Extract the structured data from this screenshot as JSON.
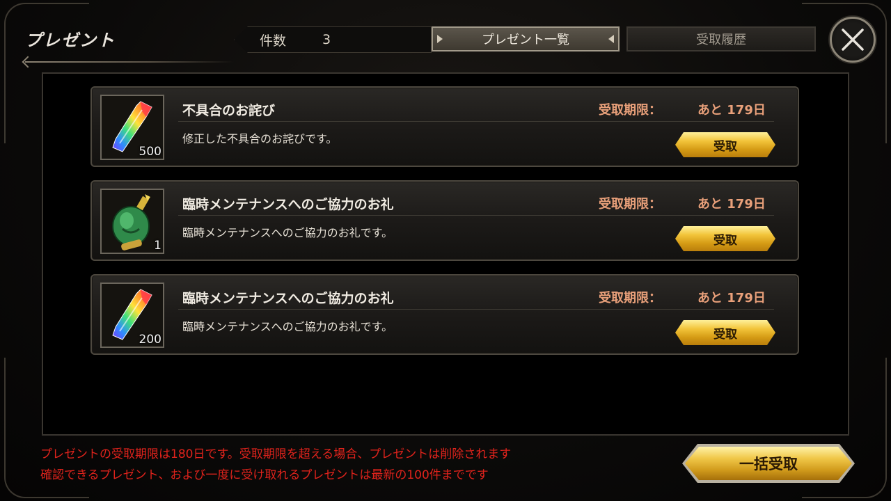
{
  "header": {
    "title": "プレゼント",
    "count_label": "件数",
    "count_value": "3",
    "tabs": [
      {
        "label": "プレゼント一覧",
        "active": true
      },
      {
        "label": "受取履歴",
        "active": false
      }
    ],
    "close_icon": "close-icon"
  },
  "presents": [
    {
      "title": "不具合のお詫び",
      "description": "修正した不具合のお詫びです。",
      "limit_label": "受取期限：",
      "limit_value": "あと 179日",
      "quantity": "500",
      "icon": "rainbow-crystal-icon",
      "button_label": "受取"
    },
    {
      "title": "臨時メンテナンスへのご協力のお礼",
      "description": "臨時メンテナンスへのご協力のお礼です。",
      "limit_label": "受取期限：",
      "limit_value": "あと 179日",
      "quantity": "1",
      "icon": "green-potion-icon",
      "button_label": "受取"
    },
    {
      "title": "臨時メンテナンスへのご協力のお礼",
      "description": "臨時メンテナンスへのご協力のお礼です。",
      "limit_label": "受取期限：",
      "limit_value": "あと 179日",
      "quantity": "200",
      "icon": "rainbow-crystal-icon",
      "button_label": "受取"
    }
  ],
  "footer": {
    "notice_lines": [
      "プレゼントの受取期限は180日です。受取期限を超える場合、プレゼントは削除されます",
      "確認できるプレゼント、および一度に受け取れるプレゼントは最新の100件までです"
    ],
    "bulk_receive_label": "一括受取"
  },
  "colors": {
    "limit_text": "#e9a07a",
    "notice_text": "#e0231c",
    "gold_button": "#f2c43a"
  }
}
